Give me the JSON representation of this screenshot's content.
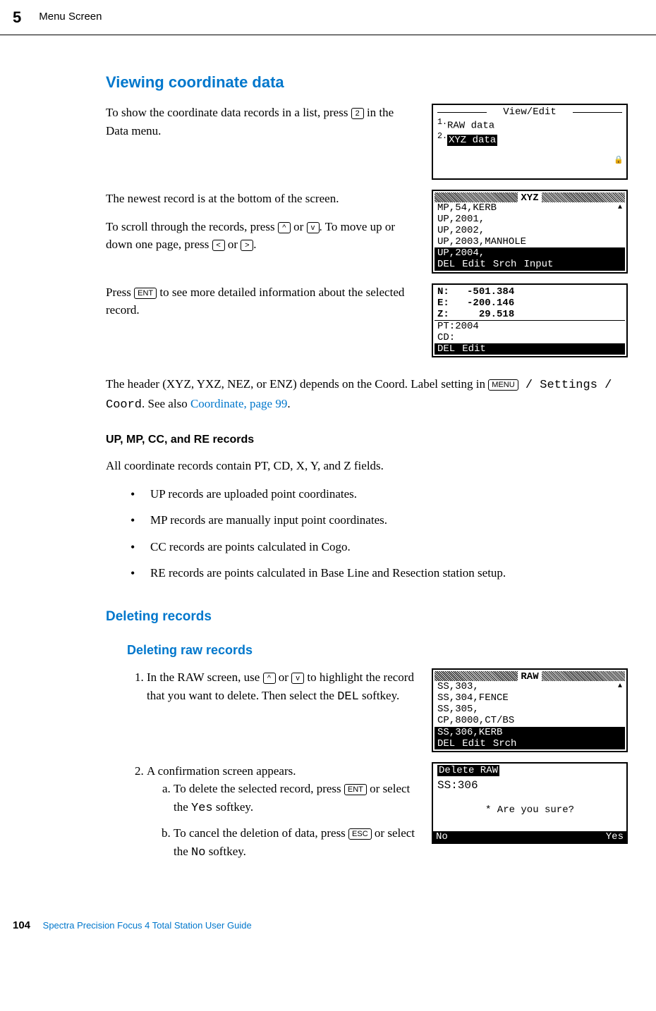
{
  "header": {
    "chapter_num": "5",
    "chapter_title": "Menu Screen"
  },
  "sections": {
    "viewing_title": "Viewing coordinate data",
    "viewing_p1a": "To show the coordinate data records in a list, press ",
    "key2": "2",
    "viewing_p1b": " in the Data menu.",
    "viewing_p2": "The newest record is at the bottom of the screen.",
    "viewing_p3a": "To scroll through the records, press ",
    "key_up": "^",
    "or1": " or ",
    "key_down": "v",
    "viewing_p3b": ". To move up or down one page, press ",
    "key_left": "<",
    "or2": " or ",
    "key_right": ">",
    "period": ".",
    "viewing_p4a": "Press ",
    "key_ent": "ENT",
    "viewing_p4b": " to see more detailed information about the selected record.",
    "viewing_p5a": "The header (XYZ, YXZ, NEZ, or ENZ) depends on the Coord. Label setting in ",
    "key_menu": "MENU",
    "menu_path": " / Settings / Coord",
    "viewing_p5b": ". See also ",
    "coord_link": "Coordinate, page 99",
    "records_h4": "UP, MP, CC, and RE records",
    "records_p": "All coordinate records contain PT, CD, X, Y, and Z fields.",
    "records_li1": "UP records are uploaded point coordinates.",
    "records_li2": "MP records are manually input point coordinates.",
    "records_li3": "CC records are points calculated in Cogo.",
    "records_li4": "RE records are points calculated in Base Line and Resection station setup.",
    "deleting_title": "Deleting records",
    "deleting_raw_title": "Deleting raw records",
    "del_step1a": "In the RAW screen, use ",
    "del_step1b": " to highlight the record that you want to delete. Then select the ",
    "del_softkey": "DEL",
    "del_step1c": " softkey.",
    "del_step2": "A confirmation screen appears.",
    "del_step2a_a": "To delete the selected record, press ",
    "del_step2a_b": " or select the ",
    "yes_softkey": "Yes",
    "softkey_suffix": " softkey.",
    "del_step2b_a": "To cancel the deletion of data, press ",
    "key_esc": "ESC",
    "del_step2b_b": " or select the ",
    "no_softkey": "No"
  },
  "lcd1": {
    "title": "View/Edit",
    "opt1_num": "1.",
    "opt1": "RAW data",
    "opt2_num": "2.",
    "opt2": "XYZ data"
  },
  "lcd2": {
    "title": "XYZ",
    "line1": "MP,54,KERB",
    "line2": "UP,2001,",
    "line3": "UP,2002,",
    "line4": "UP,2003,MANHOLE",
    "line5": "UP,2004,",
    "sk1": "DEL",
    "sk2": "Edit",
    "sk3": "Srch",
    "sk4": "Input"
  },
  "lcd3": {
    "n_label": "N:",
    "n_val": "   -501.384",
    "e_label": "E:",
    "e_val": "   -200.146",
    "z_label": "Z:",
    "z_val": "     29.518",
    "pt": "PT:2004",
    "cd": "CD:",
    "sk1": "DEL",
    "sk2": "Edit"
  },
  "lcd4": {
    "title": "RAW",
    "line1": "SS,303,",
    "line2": "SS,304,FENCE",
    "line3": "SS,305,",
    "line4": "CP,8000,CT/BS",
    "line5": "SS,306,KERB",
    "sk1": "DEL",
    "sk2": "Edit",
    "sk3": "Srch"
  },
  "lcd5": {
    "title": "Delete RAW",
    "line1": "SS:306",
    "prompt": "* Are you sure?",
    "sk_no": "No",
    "sk_yes": "Yes"
  },
  "footer": {
    "page": "104",
    "text": "Spectra Precision Focus 4 Total Station User Guide"
  }
}
